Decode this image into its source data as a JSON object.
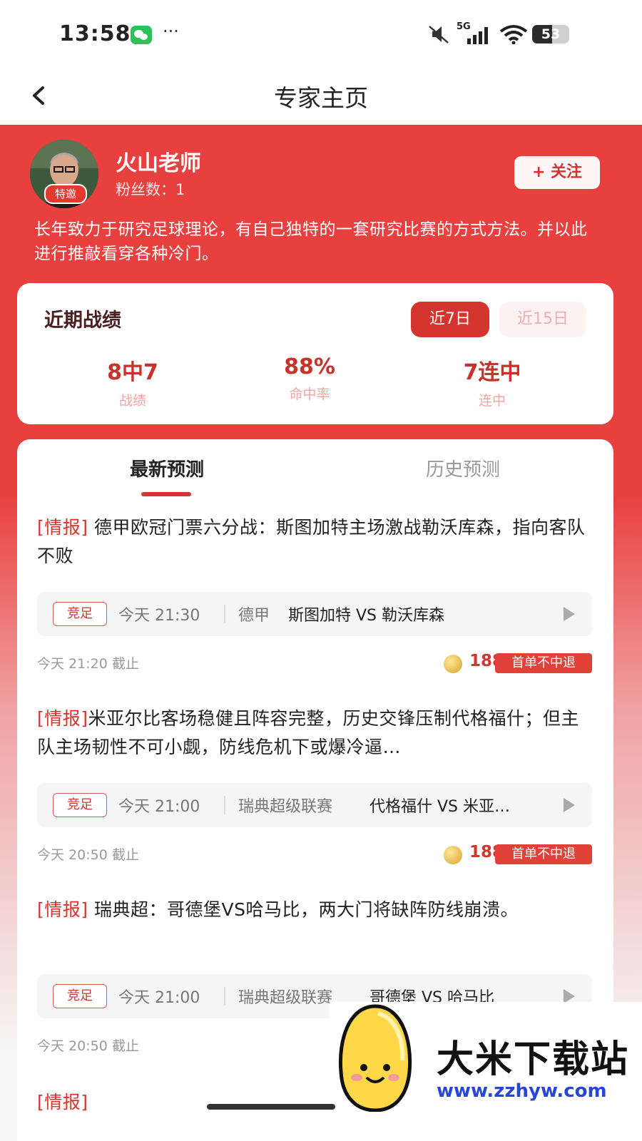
{
  "status_bar": {
    "time": "13:58",
    "network": "5G",
    "battery": "53",
    "battery_level": 0.53,
    "icons": [
      "wechat-icon",
      "more-dots-icon",
      "mute-icon",
      "signal-icon",
      "wifi-icon",
      "battery-icon"
    ]
  },
  "nav": {
    "title": "专家主页",
    "back_icon": "chevron-left-icon"
  },
  "profile": {
    "name": "火山老师",
    "badge": "特邀",
    "fans": "粉丝数：1",
    "follow_label": "+ 关注",
    "intro": "长年致力于研究足球理论，有自己独特的一套研究比赛的方式方法。并以此进行推敲看穿各种冷门。"
  },
  "record": {
    "title": "近期战绩",
    "tabs": [
      {
        "label": "近7日",
        "active": true
      },
      {
        "label": "近15日",
        "active": false
      }
    ],
    "stats": [
      {
        "value": "8中7",
        "label": "战绩"
      },
      {
        "value": "88%",
        "label": "命中率"
      },
      {
        "value": "7连中",
        "label": "连中"
      }
    ]
  },
  "list": {
    "tabs": [
      {
        "label": "最新预测",
        "active": true
      },
      {
        "label": "历史预测",
        "active": false
      }
    ],
    "items": [
      {
        "tag": "[情报]",
        "text": "德甲欧冠门票六分战：斯图加特主场激战勒沃库森，指向客队不败",
        "type": "竞足",
        "time": "今天 21:30",
        "league": "德甲",
        "teams": "斯图加特 VS 勒沃库森",
        "deadline": "今天 21:20 截止",
        "price": "188",
        "badge": "首单不中退"
      },
      {
        "tag": "[情报]",
        "text": "米亚尔比客场稳健且阵容完整，历史交锋压制代格福什；但主队主场韧性不可小觑，防线危机下或爆冷逼…",
        "type": "竞足",
        "time": "今天 21:00",
        "league": "瑞典超级联赛",
        "teams": "代格福什 VS 米亚…",
        "deadline": "今天 20:50 截止",
        "price": "188",
        "badge": "首单不中退"
      },
      {
        "tag": "[情报]",
        "text": "瑞典超：哥德堡VS哈马比，两大门将缺阵防线崩溃。",
        "type": "竞足",
        "time": "今天 21:00",
        "league": "瑞典超级联赛",
        "teams": "哥德堡 VS 哈马比",
        "deadline": "今天 20:50 截止"
      }
    ],
    "partial_tag": "[情报]"
  },
  "watermark": {
    "title": "大米下载站",
    "url": "www.zzhyw.com"
  },
  "colors": {
    "brand_red": "#e8403f",
    "accent_red": "#d4362f",
    "watermark_url": "#2846d6"
  }
}
